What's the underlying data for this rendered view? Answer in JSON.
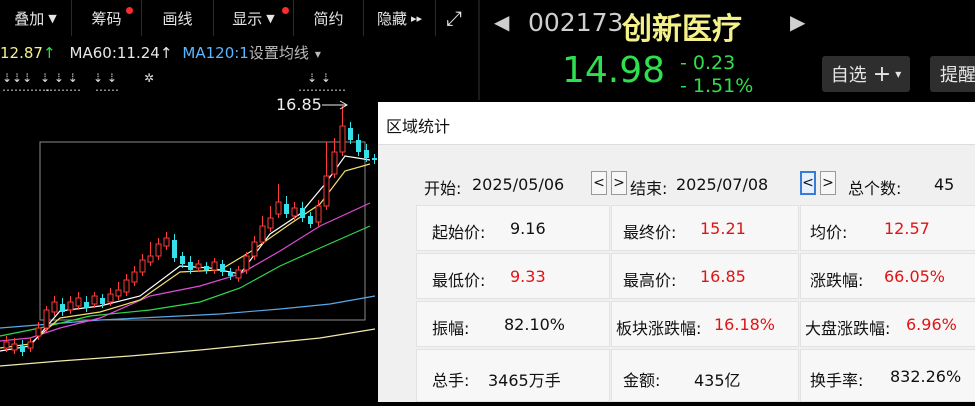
{
  "toolbar": {
    "buttons": [
      {
        "label": "叠加",
        "arrow": "▼"
      },
      {
        "label": "筹码"
      },
      {
        "label": "画线"
      },
      {
        "label": "显示",
        "arrow": "▼"
      },
      {
        "label": "简约"
      },
      {
        "label": "隐藏",
        "arrow": "▸▸"
      }
    ],
    "expand_icon": "⤢"
  },
  "ma_bar": {
    "ma_partial": "12.87",
    "ma60": "MA60:11.24",
    "ma120": "MA120:1",
    "setting": "设置均线",
    "up_arrow": "↑",
    "dropdown": "▾"
  },
  "chart": {
    "high_label": "16.85",
    "colors": {
      "up": "#ff3b3b",
      "down": "#35e0e8",
      "ma5": "#ffffff",
      "ma10": "#f4e06a",
      "ma20": "#e04bd8",
      "ma60": "#31d84c",
      "ma120": "#5aa9e6",
      "ma250": "#eeeaa8"
    }
  },
  "quote": {
    "code": "002173",
    "name": "创新医疗",
    "price": "14.98",
    "change": "- 0.23",
    "change_pct": "- 1.51%",
    "prev_arrow": "◀",
    "next_arrow": "▶",
    "zixuan": "自选",
    "zixuan_plus": "+",
    "zixuan_caret": "▾",
    "tixing": "提醒"
  },
  "dialog": {
    "title": "区域统计",
    "start_label": "开始:",
    "start_date": "2025/05/06",
    "end_label": "结束:",
    "end_date": "2025/07/08",
    "total_label": "总个数:",
    "total_count": "45",
    "prev_btn": "<",
    "next_btn": ">",
    "stats": {
      "open_label": "起始价:",
      "open_value": "9.16",
      "close_label": "最终价:",
      "close_value": "15.21",
      "avg_label": "均价:",
      "avg_value": "12.57",
      "low_label": "最低价:",
      "low_value": "9.33",
      "high_label": "最高价:",
      "high_value": "16.85",
      "change_label": "涨跌幅:",
      "change_value": "66.05%",
      "amp_label": "振幅:",
      "amp_value": "82.10%",
      "sector_label": "板块涨跌幅:",
      "sector_value": "16.18%",
      "market_label": "大盘涨跌幅:",
      "market_value": "6.96%",
      "volume_label": "总手:",
      "volume_value": "3465万手",
      "amount_label": "金额:",
      "amount_value": "435亿",
      "turnover_label": "换手率:",
      "turnover_value": "832.26%"
    }
  }
}
